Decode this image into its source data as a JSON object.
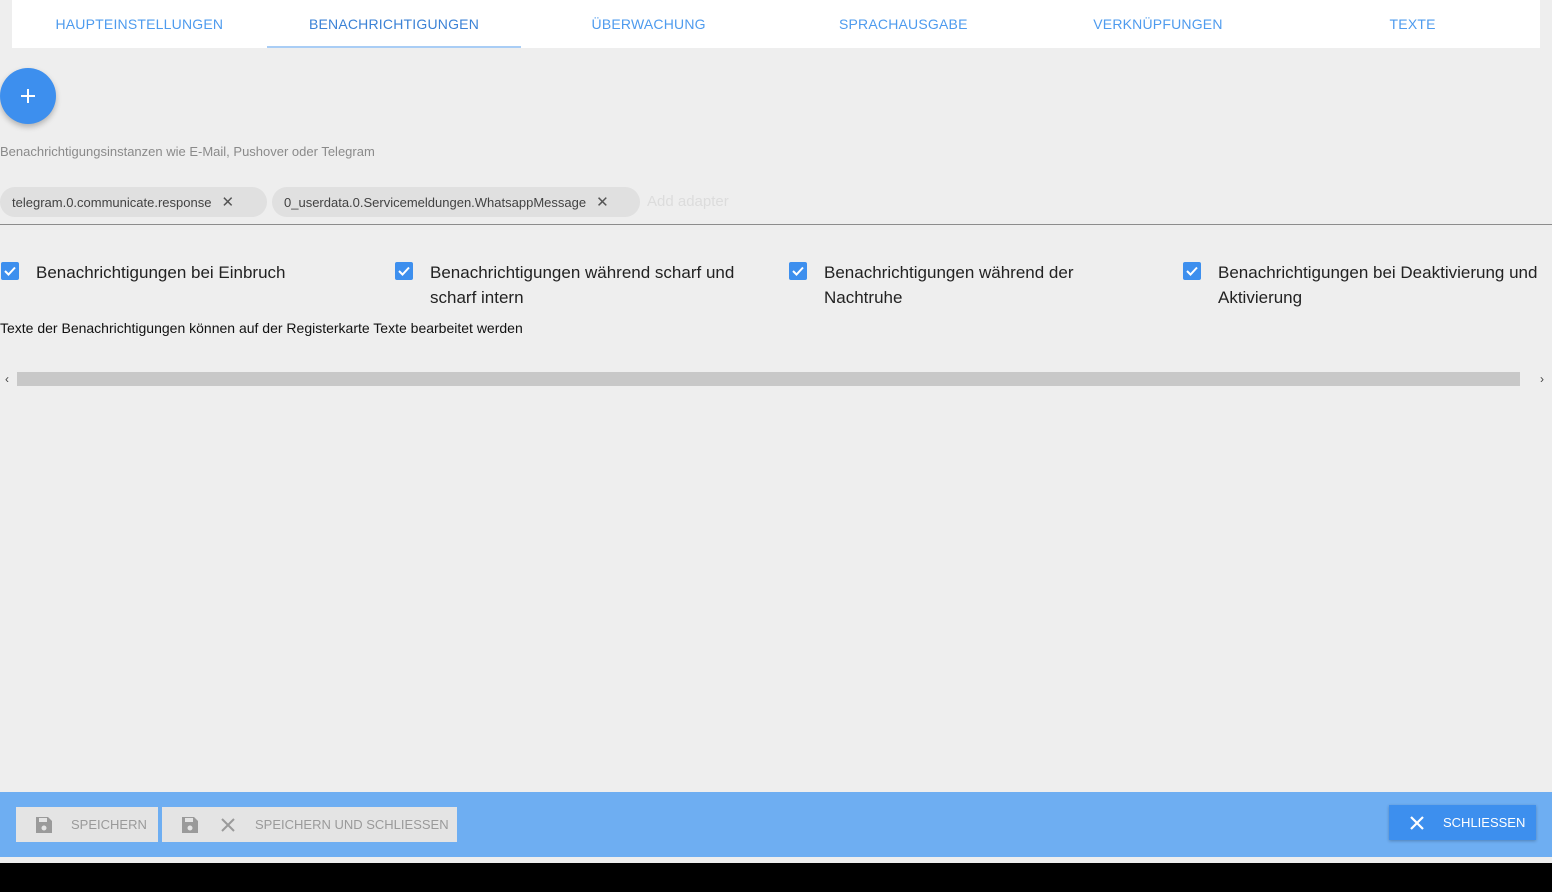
{
  "tabs": [
    {
      "label": "HAUPTEINSTELLUNGEN",
      "active": false
    },
    {
      "label": "BENACHRICHTIGUNGEN",
      "active": true
    },
    {
      "label": "ÜBERWACHUNG",
      "active": false
    },
    {
      "label": "SPRACHAUSGABE",
      "active": false
    },
    {
      "label": "VERKNÜPFUNGEN",
      "active": false
    },
    {
      "label": "TEXTE",
      "active": false
    }
  ],
  "add_button_icon": "plus-icon",
  "instances": {
    "label": "Benachrichtigungsinstanzen wie E-Mail, Pushover oder Telegram",
    "chips": [
      "telegram.0.communicate.response",
      "0_userdata.0.Servicemeldungen.WhatsappMessage"
    ],
    "placeholder": "Add adapter"
  },
  "checkboxes": [
    {
      "label": "Benachrichtigungen bei Einbruch",
      "checked": true
    },
    {
      "label": "Benachrichtigungen während scharf und scharf intern",
      "checked": true
    },
    {
      "label": "Benachrichtigungen während der Nachtruhe",
      "checked": true
    },
    {
      "label": "Benachrichtigungen bei Deaktivierung und Aktivierung",
      "checked": true
    }
  ],
  "note": "Texte der Benachrichtigungen können auf der Registerkarte Texte bearbeitet werden",
  "footer": {
    "save_label": "SPEICHERN",
    "save_close_label": "SPEICHERN UND SCHLIESSEN",
    "close_label": "SCHLIESSEN"
  },
  "colors": {
    "accent": "#3d8fee",
    "tab_text": "#4e9bee",
    "footer_bg": "#6eaef2",
    "page_bg": "#eeeeee"
  }
}
